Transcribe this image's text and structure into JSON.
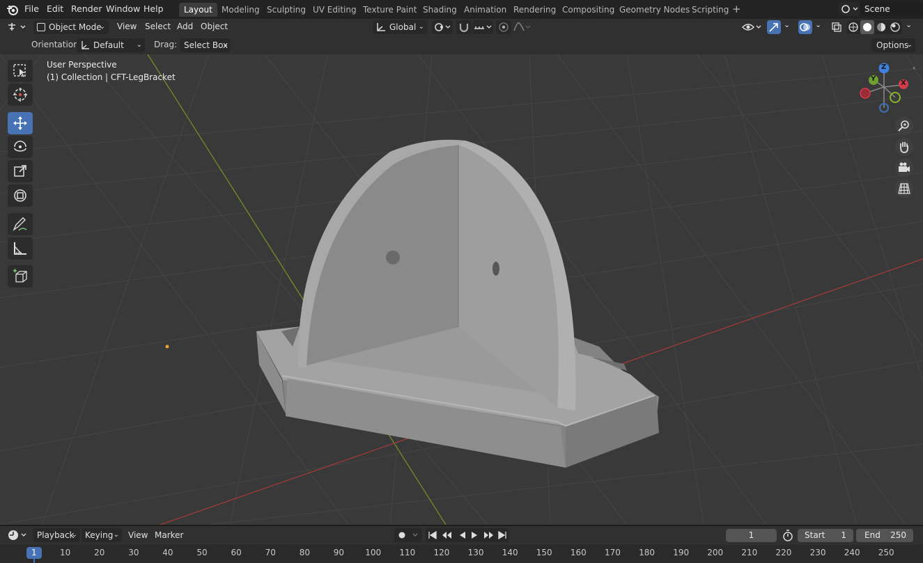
{
  "menubar": {
    "items": [
      "File",
      "Edit",
      "Render",
      "Window",
      "Help"
    ],
    "workspaces": [
      "Layout",
      "Modeling",
      "Sculpting",
      "UV Editing",
      "Texture Paint",
      "Shading",
      "Animation",
      "Rendering",
      "Compositing",
      "Geometry Nodes",
      "Scripting"
    ],
    "active_workspace": "Layout",
    "add_tab": "+",
    "scene_label": "Scene"
  },
  "header": {
    "mode": "Object Mode",
    "menus": [
      "View",
      "Select",
      "Add",
      "Object"
    ],
    "transform_orientation": "Global",
    "orientation_label": "Orientation:",
    "orientation_value": "Default",
    "drag_label": "Drag:",
    "drag_value": "Select Box",
    "options_label": "Options"
  },
  "viewport": {
    "perspective_label": "User Perspective",
    "collection_label": "(1) Collection | CFT-LegBracket",
    "gizmo_axes": {
      "z": "Z",
      "y": "Y",
      "x": "X"
    },
    "colors": {
      "background": "#393939",
      "grid": "#454545",
      "x_axis": "#a13a3a",
      "y_axis": "#6f8f2a",
      "active_tool": "#4772b3",
      "model": "#9a9a9a"
    }
  },
  "tools": [
    {
      "name": "select-box-icon"
    },
    {
      "name": "cursor-icon"
    },
    {
      "name": "move-icon",
      "active": true
    },
    {
      "name": "rotate-icon"
    },
    {
      "name": "scale-icon"
    },
    {
      "name": "transform-icon"
    },
    {
      "name": "annotate-icon"
    },
    {
      "name": "measure-icon"
    },
    {
      "name": "add-cube-icon"
    }
  ],
  "timeline": {
    "menus": [
      "Playback",
      "Keying",
      "View",
      "Marker"
    ],
    "current_frame": "1",
    "start_label": "Start",
    "start_value": "1",
    "end_label": "End",
    "end_value": "250",
    "ruler_ticks": [
      "1",
      "10",
      "20",
      "30",
      "40",
      "50",
      "60",
      "70",
      "80",
      "90",
      "100",
      "110",
      "120",
      "130",
      "140",
      "150",
      "160",
      "170",
      "180",
      "190",
      "200",
      "210",
      "220",
      "230",
      "240",
      "250"
    ]
  }
}
